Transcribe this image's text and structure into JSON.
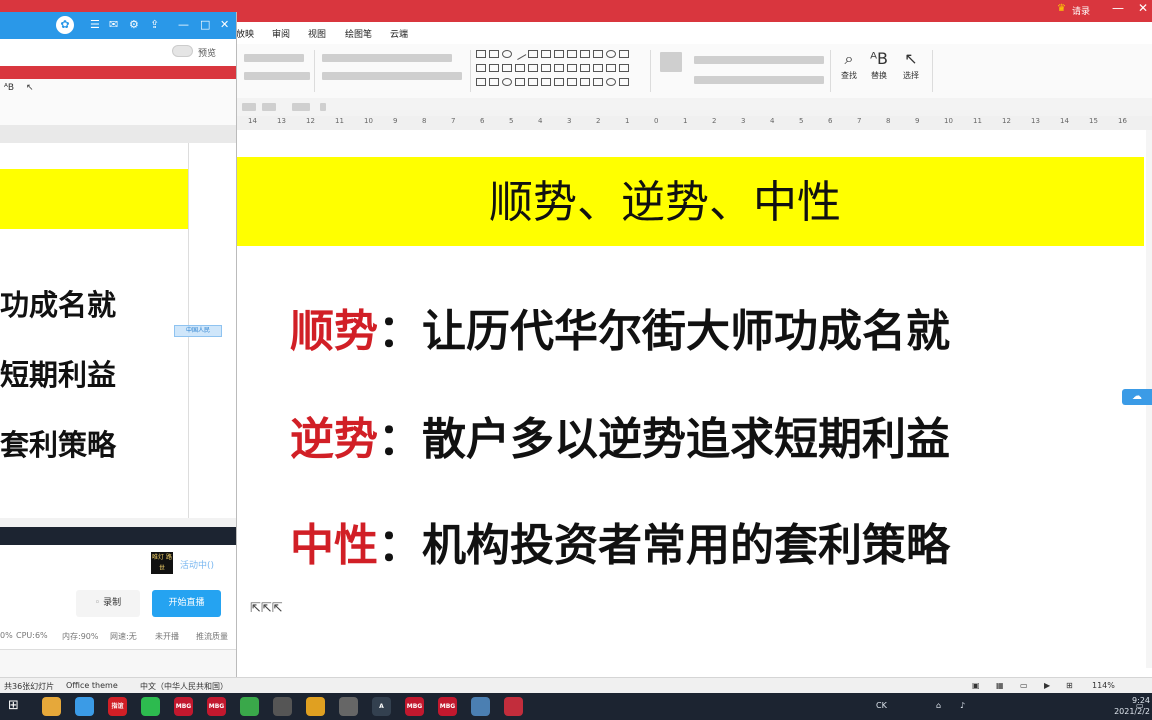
{
  "main": {
    "user_name": "请录",
    "menu_tabs": [
      "放映",
      "审阅",
      "视图",
      "绘图笔",
      "云端"
    ],
    "ribbon_tools": {
      "find": "查找",
      "replace": "替换",
      "select": "选择"
    },
    "ruler_ticks": [
      "14",
      "13",
      "12",
      "11",
      "10",
      "9",
      "8",
      "7",
      "6",
      "5",
      "4",
      "3",
      "2",
      "1",
      "0",
      "1",
      "2",
      "3",
      "4",
      "5",
      "6",
      "7",
      "8",
      "9",
      "10",
      "11",
      "12",
      "13",
      "14",
      "15",
      "16"
    ]
  },
  "slide": {
    "title": "顺势、逆势、中性",
    "lines": [
      {
        "keyword": "顺势",
        "text": "：让历代华尔街大师功成名就"
      },
      {
        "keyword": "逆势",
        "text": "：散户多以逆势追求短期利益"
      },
      {
        "keyword": "中性",
        "text": "：机构投资者常用的套利策略"
      }
    ]
  },
  "statusbar": {
    "slide_count": "共36张幻灯片",
    "theme": "Office theme",
    "language": "中文（中华人民共和国）",
    "zoom": "114%"
  },
  "taskbar": {
    "icons": [
      {
        "name": "file-explorer-icon",
        "color": "#e6a83a",
        "label": ""
      },
      {
        "name": "qq-icon",
        "color": "#3b9be6",
        "label": ""
      },
      {
        "name": "huomao-icon",
        "color": "#d11f26",
        "label": "指谊"
      },
      {
        "name": "wechat-icon",
        "color": "#2dbb4f",
        "label": ""
      },
      {
        "name": "mbg-icon-1",
        "color": "#c2182e",
        "label": "MBG"
      },
      {
        "name": "mbg-icon-2",
        "color": "#c2182e",
        "label": "MBG"
      },
      {
        "name": "green-app-icon",
        "color": "#3aa84a",
        "label": ""
      },
      {
        "name": "circle-app-icon",
        "color": "#555",
        "label": ""
      },
      {
        "name": "triangle-app-icon",
        "color": "#e0a021",
        "label": ""
      },
      {
        "name": "record-app-icon",
        "color": "#666",
        "label": ""
      },
      {
        "name": "a-app-icon",
        "color": "#33404f",
        "label": "A"
      },
      {
        "name": "mbg-icon-3",
        "color": "#c2182e",
        "label": "MBG"
      },
      {
        "name": "mbg-icon-4",
        "color": "#c2182e",
        "label": "MBG"
      },
      {
        "name": "pen-app-icon",
        "color": "#4b7fb2",
        "label": ""
      },
      {
        "name": "red-app-icon",
        "color": "#c22d3c",
        "label": ""
      }
    ],
    "tray_ime": "CK",
    "time": "9:24",
    "date": "2021/2/2"
  },
  "overlay": {
    "title_icons": [
      "☰",
      "✉",
      "⚙",
      "⇪",
      "—",
      "□",
      "✕"
    ],
    "preview_label": "预览",
    "mini_lines": [
      "功成名就",
      "短期利益",
      "套利策略"
    ],
    "mini_tag": "中国人民",
    "live_status": "活动中()",
    "logo_text": "唯灯 路世",
    "record_label": "录制",
    "start_label": "开始直播",
    "stats": [
      "0%",
      "CPU:6%",
      "内存:90%",
      "网速:无",
      "未开播",
      "推流质量"
    ],
    "accent": "#25a3f1"
  }
}
